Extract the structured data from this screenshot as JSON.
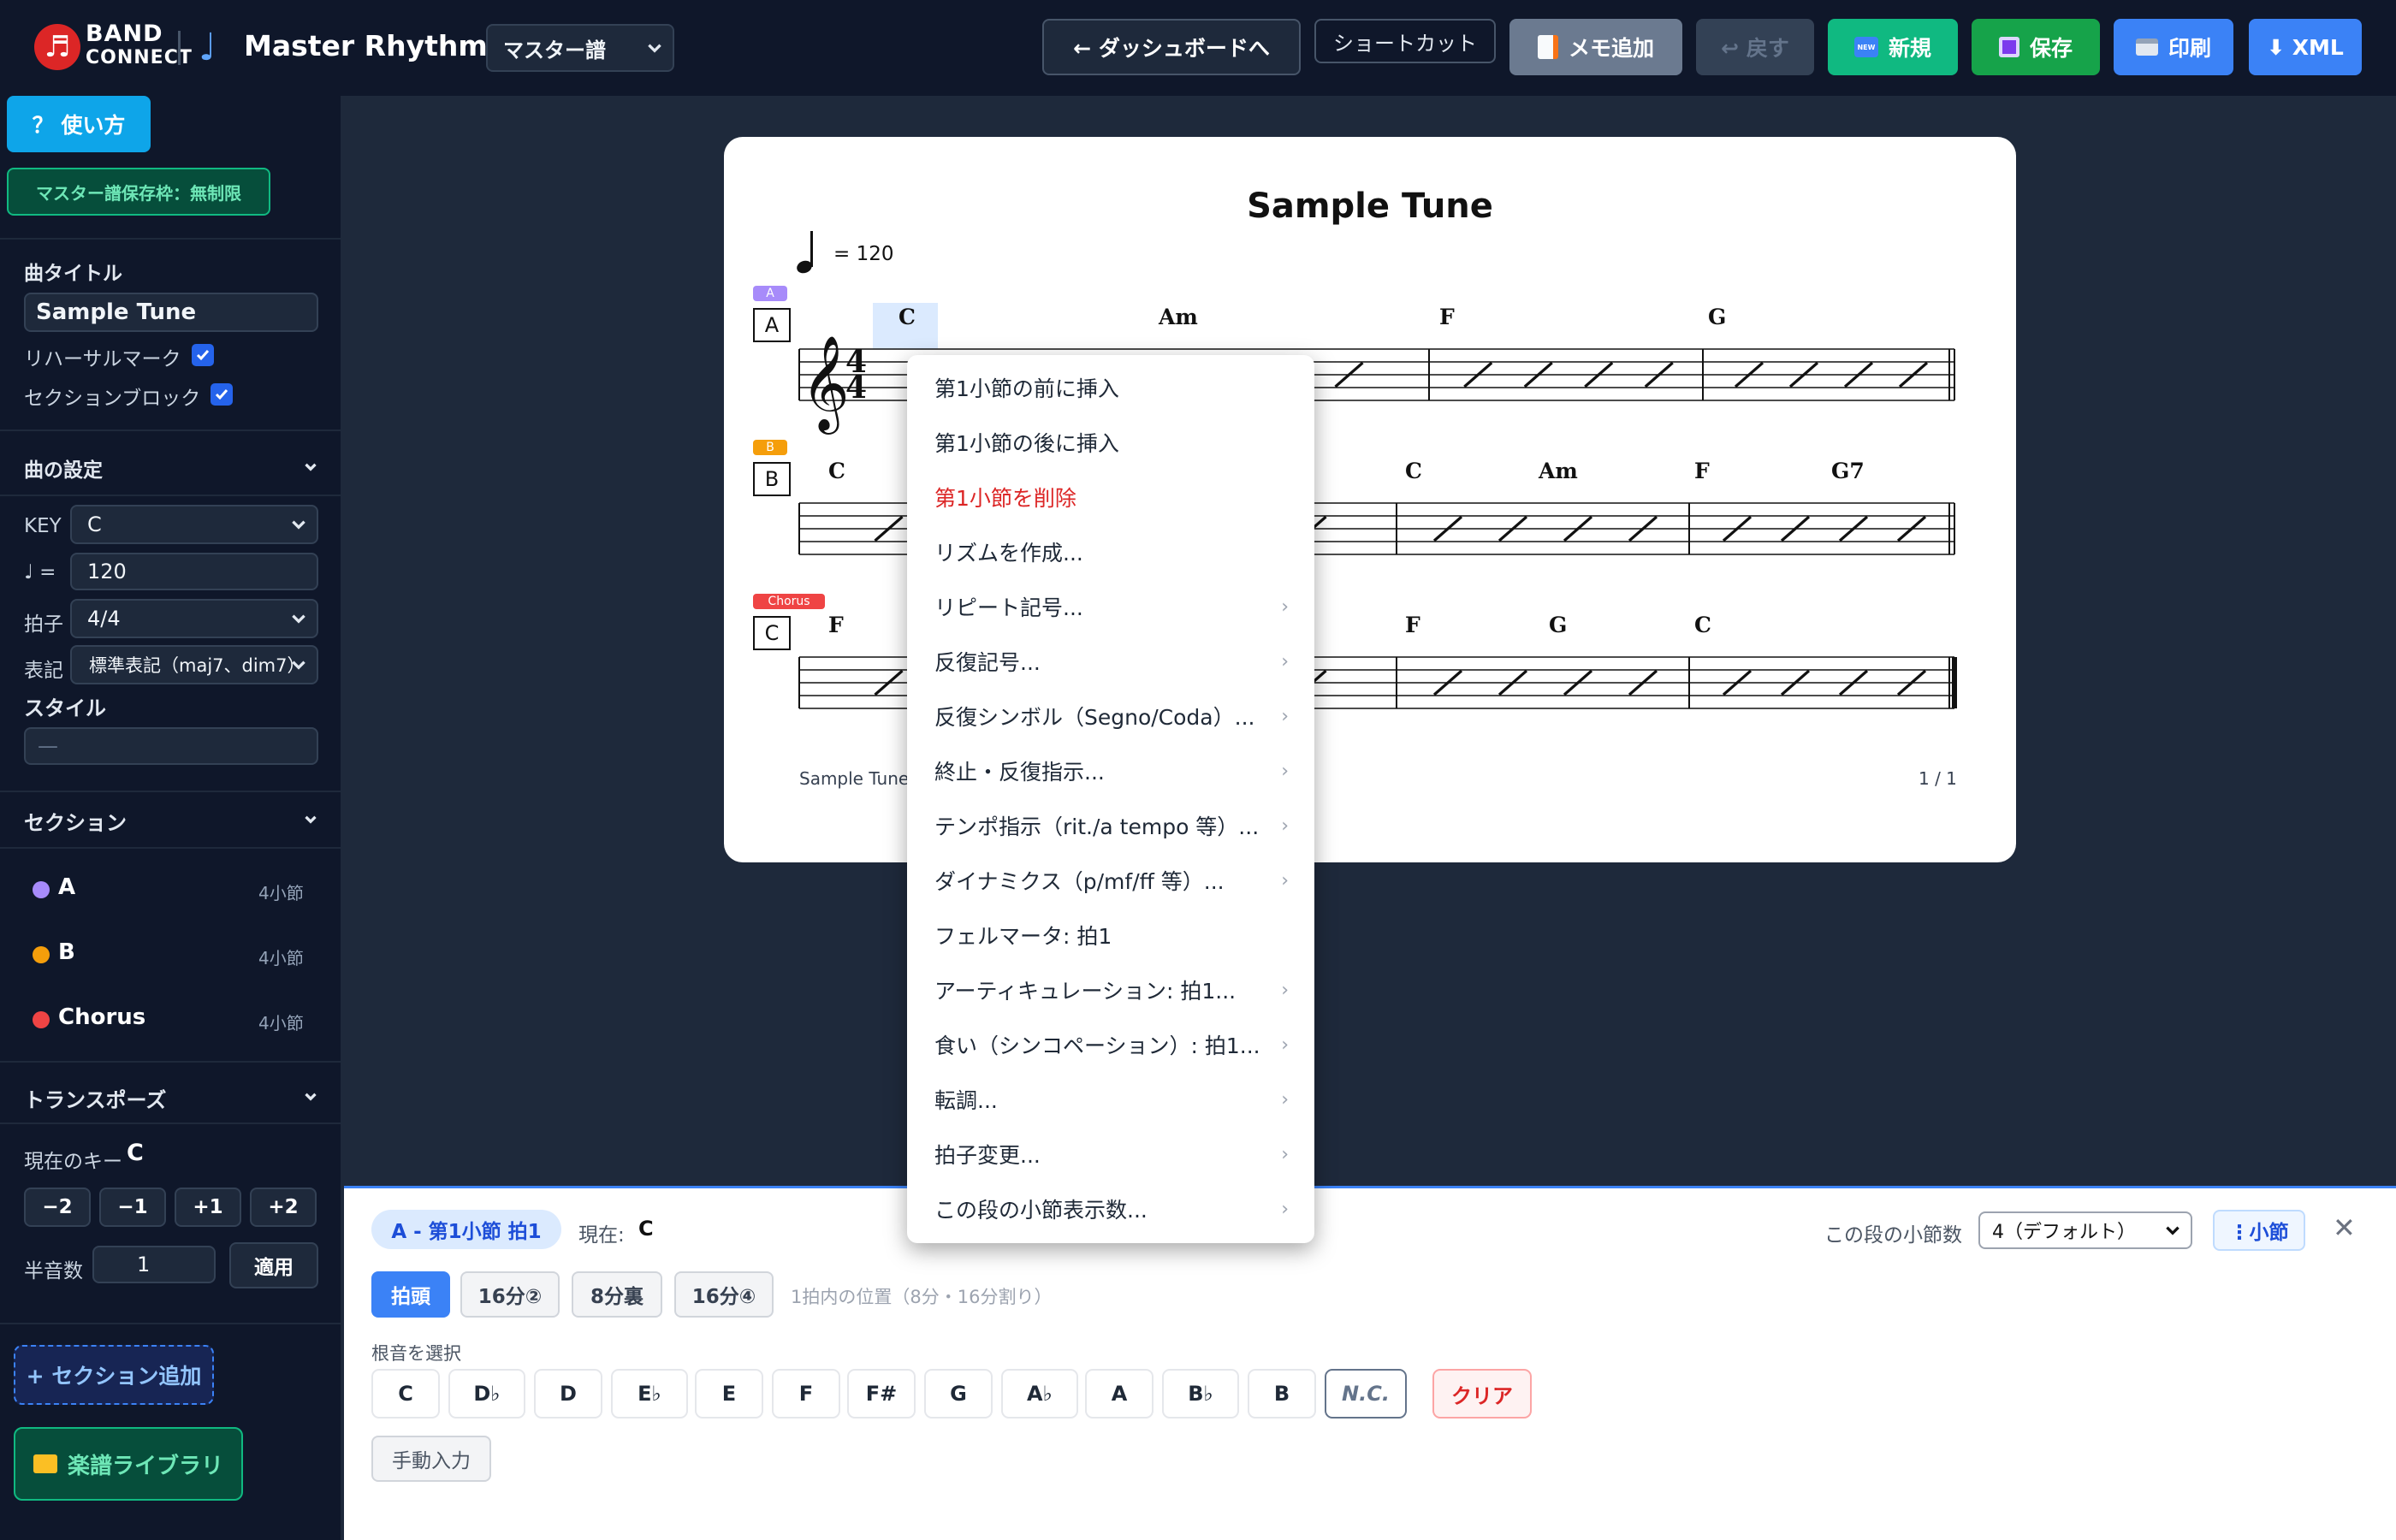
{
  "header": {
    "logo_letter": "♬",
    "logo_line1": "BAND",
    "logo_line2": "CONNECT",
    "note_glyph": "♩",
    "app_title": "Master Rhythm",
    "mode_select": "マスター譜",
    "buttons": {
      "dashboard": "← ダッシュボードへ",
      "shortcut": "ショートカット",
      "memo": "メモ追加",
      "undo": "↩ 戻す",
      "new": "新規",
      "new_badge": "NEW",
      "save": "保存",
      "print": "印刷",
      "xml": "⬇ XML"
    },
    "colors": {
      "memo": "#6b7a90",
      "undo": "#334155",
      "new": "#10b981",
      "save": "#16a34a",
      "print": "#3b82f6",
      "xml": "#3b82f6"
    }
  },
  "sidebar": {
    "help_button": "？ 使い方",
    "storage_badge": "マスター譜保存枠：無制限",
    "song_title_label": "曲タイトル",
    "song_title_value": "Sample Tune",
    "rehearsal_mark_label": "リハーサルマーク",
    "rehearsal_mark_checked": true,
    "section_block_label": "セクションブロック",
    "section_block_checked": true,
    "song_settings_heading": "曲の設定",
    "key_label": "KEY",
    "key_value": "C",
    "tempo_label": "♩ =",
    "tempo_value": "120",
    "time_sig_label": "拍子",
    "time_sig_value": "4/4",
    "notation_label": "表記",
    "notation_value": "標準表記（maj7、dim7）",
    "style_label": "スタイル",
    "style_placeholder": "—",
    "sections_heading": "セクション",
    "sections": [
      {
        "name": "A",
        "bars": "4小節",
        "color": "#a78bfa"
      },
      {
        "name": "B",
        "bars": "4小節",
        "color": "#f59e0b"
      },
      {
        "name": "Chorus",
        "bars": "4小節",
        "color": "#ef4444"
      }
    ],
    "transpose_heading": "トランスポーズ",
    "current_key_label": "現在のキー",
    "current_key_value": "C",
    "transpose_buttons": [
      "−2",
      "−1",
      "+1",
      "+2"
    ],
    "semitone_label": "半音数",
    "semitone_value": "1",
    "apply_button": "適用",
    "add_section_button": "+ セクション追加",
    "library_button": "楽譜ライブラリ"
  },
  "score": {
    "title": "Sample Tune",
    "tempo_text": "= 120",
    "footer_title": "Sample Tune",
    "page_number": "1 / 1",
    "rows": [
      {
        "mark": "A",
        "tag": "A",
        "tag_color": "#a78bfa",
        "chords": [
          "C",
          "Am",
          "F",
          "G"
        ]
      },
      {
        "mark": "B",
        "tag": "B",
        "tag_color": "#f59e0b",
        "chords": [
          "C",
          "C",
          "Am",
          "F",
          "G7"
        ]
      },
      {
        "mark": "C",
        "tag": "Chorus",
        "tag_color": "#ef4444",
        "chords": [
          "F",
          "F",
          "G",
          "C"
        ]
      }
    ]
  },
  "context_menu": {
    "items": [
      {
        "label": "第1小節の前に挿入",
        "has_sub": false,
        "danger": false
      },
      {
        "label": "第1小節の後に挿入",
        "has_sub": false,
        "danger": false
      },
      {
        "label": "第1小節を削除",
        "has_sub": false,
        "danger": true
      },
      {
        "label": "リズムを作成...",
        "has_sub": false,
        "danger": false
      },
      {
        "label": "リピート記号...",
        "has_sub": true,
        "danger": false
      },
      {
        "label": "反復記号...",
        "has_sub": true,
        "danger": false
      },
      {
        "label": "反復シンボル（Segno/Coda）...",
        "has_sub": true,
        "danger": false
      },
      {
        "label": "終止・反復指示...",
        "has_sub": true,
        "danger": false
      },
      {
        "label": "テンポ指示（rit./a tempo 等）...",
        "has_sub": true,
        "danger": false
      },
      {
        "label": "ダイナミクス（p/mf/ff 等）...",
        "has_sub": true,
        "danger": false
      },
      {
        "label": "フェルマータ: 拍1",
        "has_sub": false,
        "danger": false
      },
      {
        "label": "アーティキュレーション: 拍1...",
        "has_sub": true,
        "danger": false
      },
      {
        "label": "食い（シンコペーション）: 拍1...",
        "has_sub": true,
        "danger": false
      },
      {
        "label": "転調...",
        "has_sub": true,
        "danger": false
      },
      {
        "label": "拍子変更...",
        "has_sub": true,
        "danger": false
      },
      {
        "label": "この段の小節表示数...",
        "has_sub": true,
        "danger": false
      }
    ],
    "submenu_glyph": "›"
  },
  "editor": {
    "position_badge": "A - 第1小節 拍1",
    "current_label": "現在:",
    "current_value": "C",
    "bars_per_row_label": "この段の小節数",
    "bars_per_row_value": "4（デフォルト）",
    "bar_button": "⋮小節",
    "close_glyph": "✕",
    "beat_positions": [
      {
        "label": "拍頭",
        "active": true
      },
      {
        "label": "16分②",
        "active": false
      },
      {
        "label": "8分裏",
        "active": false
      },
      {
        "label": "16分④",
        "active": false
      }
    ],
    "beat_hint": "1拍内の位置（8分・16分割り）",
    "root_label": "根音を選択",
    "roots": [
      "C",
      "D♭",
      "D",
      "E♭",
      "E",
      "F",
      "F#",
      "G",
      "A♭",
      "A",
      "B♭",
      "B"
    ],
    "nc_button": "N.C.",
    "clear_button": "クリア",
    "manual_input_button": "手動入力"
  }
}
